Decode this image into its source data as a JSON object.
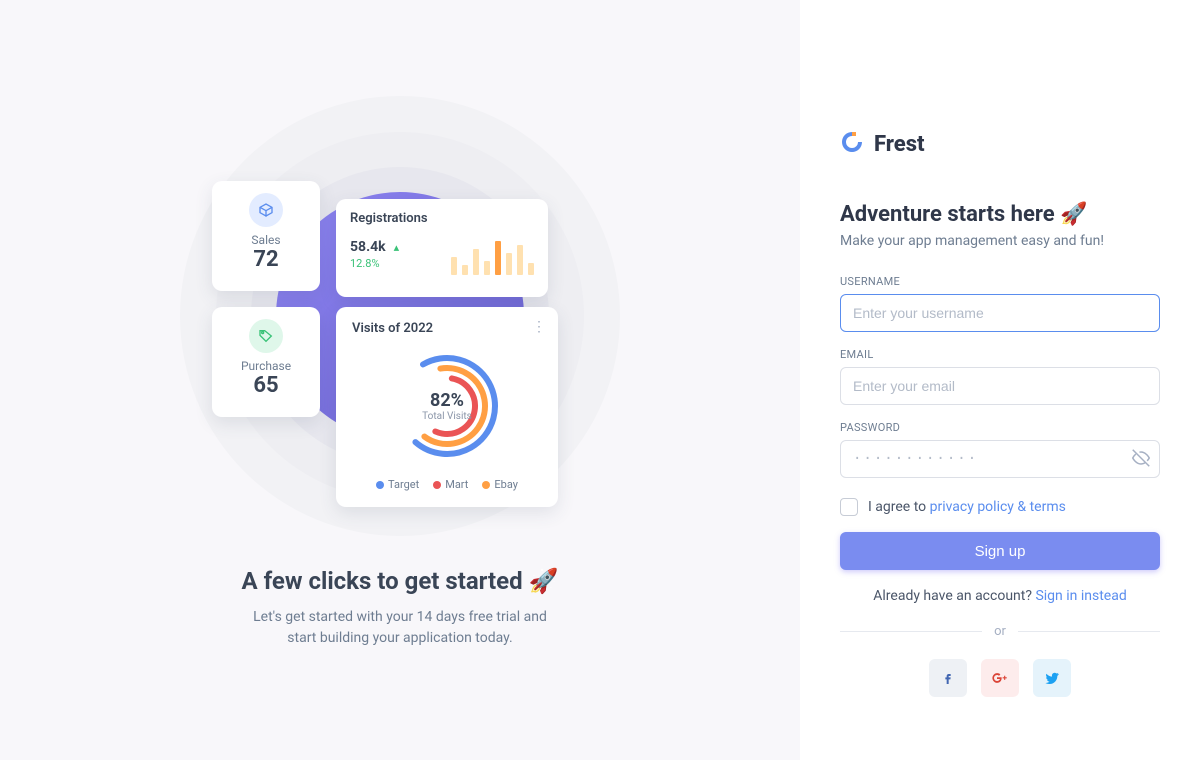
{
  "brand": {
    "name": "Frest"
  },
  "hero": {
    "title": "A few clicks to get started 🚀",
    "subtitle": "Let's get started with your 14 days free trial and start building your application today.",
    "sales": {
      "label": "Sales",
      "value": "72"
    },
    "purchase": {
      "label": "Purchase",
      "value": "65"
    },
    "reg": {
      "title": "Registrations",
      "value": "58.4k",
      "delta": "12.8%"
    },
    "visits": {
      "title": "Visits of 2022",
      "percent": "82%",
      "percent_label": "Total Visits",
      "legend": [
        {
          "name": "Target",
          "color": "#5a8dee"
        },
        {
          "name": "Mart",
          "color": "#ea5455"
        },
        {
          "name": "Ebay",
          "color": "#ff9f43"
        }
      ]
    }
  },
  "form": {
    "headline": "Adventure starts here 🚀",
    "sub": "Make your app management easy and fun!",
    "username_label": "USERNAME",
    "username_placeholder": "Enter your username",
    "email_label": "EMAIL",
    "email_placeholder": "Enter your email",
    "password_label": "PASSWORD",
    "password_placeholder": "············",
    "agree_prefix": "I agree to ",
    "agree_link": "privacy policy & terms",
    "submit": "Sign up",
    "have_account": "Already have an account? ",
    "signin": "Sign in instead",
    "or": "or"
  },
  "colors": {
    "primary": "#5a8dee",
    "accent": "#7a8cf0"
  }
}
